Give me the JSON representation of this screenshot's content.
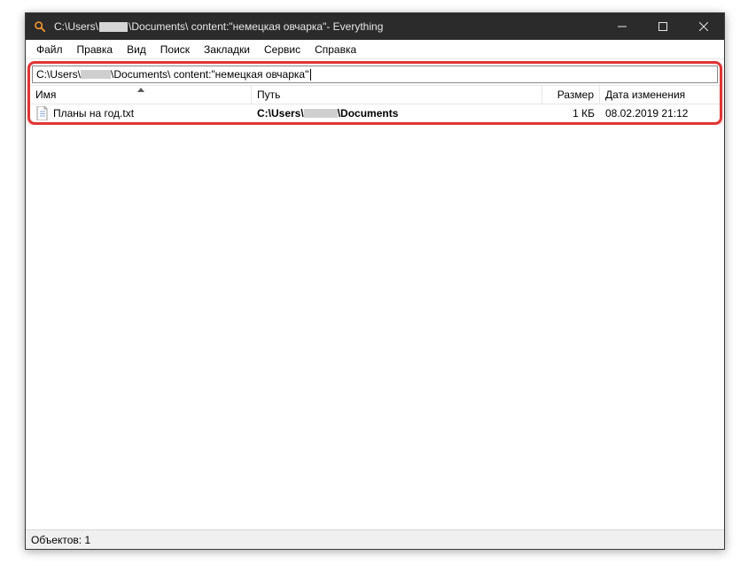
{
  "titlebar": {
    "prefix": "C:\\Users\\",
    "mid": "\\Documents\\ content:\"немецкая овчарка\"",
    "suffix": "  - Everything"
  },
  "menu": {
    "file": "Файл",
    "edit": "Правка",
    "view": "Вид",
    "search": "Поиск",
    "bookmarks": "Закладки",
    "tools": "Сервис",
    "help": "Справка"
  },
  "search": {
    "prefix": "C:\\Users\\",
    "mid": "\\Documents\\ content:\"немецкая овчарка\""
  },
  "columns": {
    "name": "Имя",
    "path": "Путь",
    "size": "Размер",
    "date": "Дата изменения"
  },
  "rows": [
    {
      "name": "Планы на год.txt",
      "path_prefix": "C:\\Users\\",
      "path_suffix": "\\Documents",
      "size": "1 КБ",
      "date": "08.02.2019 21:12"
    }
  ],
  "statusbar": {
    "objects": "Объектов: 1"
  }
}
